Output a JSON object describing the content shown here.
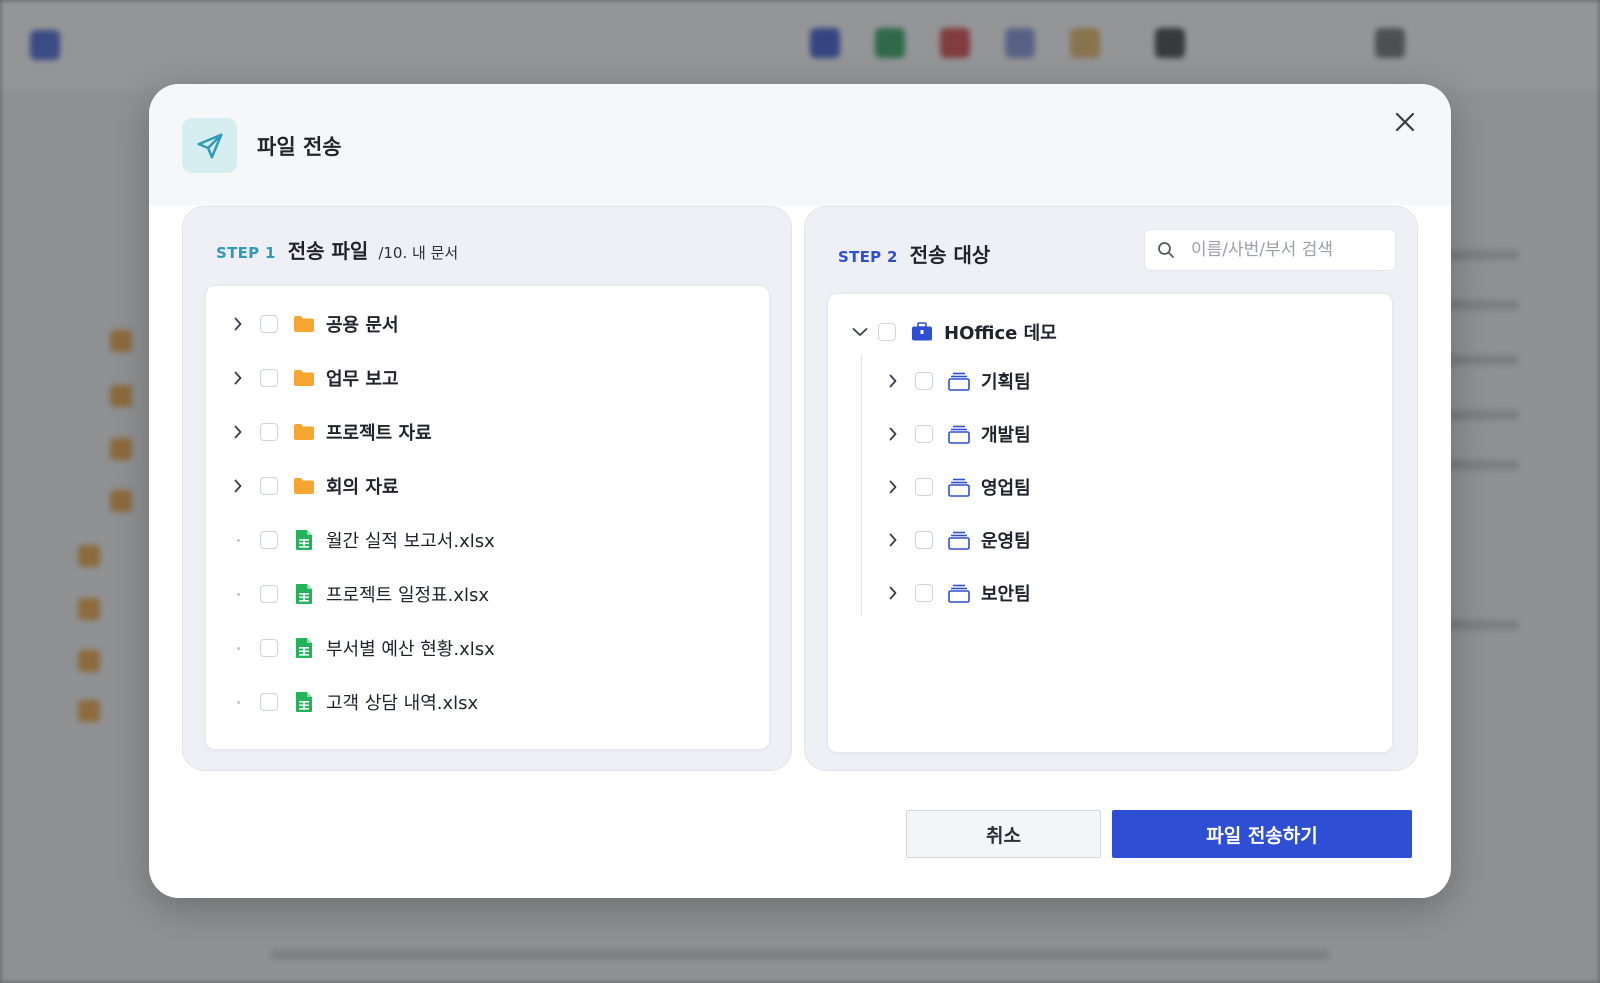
{
  "dialog": {
    "title": "파일 전송",
    "close_label": "×"
  },
  "step1": {
    "step_label": "STEP 1",
    "title": "전송 파일",
    "path": "/10. 내 문서",
    "items": [
      {
        "type": "folder",
        "label": "공용 문서"
      },
      {
        "type": "folder",
        "label": "업무 보고"
      },
      {
        "type": "folder",
        "label": "프로젝트 자료"
      },
      {
        "type": "folder",
        "label": "회의 자료"
      },
      {
        "type": "file",
        "label": "월간 실적 보고서.xlsx"
      },
      {
        "type": "file",
        "label": "프로젝트 일정표.xlsx"
      },
      {
        "type": "file",
        "label": "부서별 예산 현황.xlsx"
      },
      {
        "type": "file",
        "label": "고객 상담 내역.xlsx"
      }
    ]
  },
  "step2": {
    "step_label": "STEP 2",
    "title": "전송 대상",
    "search_placeholder": "이름/사번/부서 검색",
    "root": {
      "label": "HOffice 데모"
    },
    "teams": [
      {
        "label": "기획팀"
      },
      {
        "label": "개발팀"
      },
      {
        "label": "영업팀"
      },
      {
        "label": "운영팀"
      },
      {
        "label": "보안팀"
      }
    ]
  },
  "footer": {
    "cancel_label": "취소",
    "send_label": "파일 전송하기"
  },
  "colors": {
    "primary": "#2e4fd3",
    "step1_accent": "#2f9bb7",
    "folder": "#f7a531",
    "excel": "#22b35b"
  }
}
